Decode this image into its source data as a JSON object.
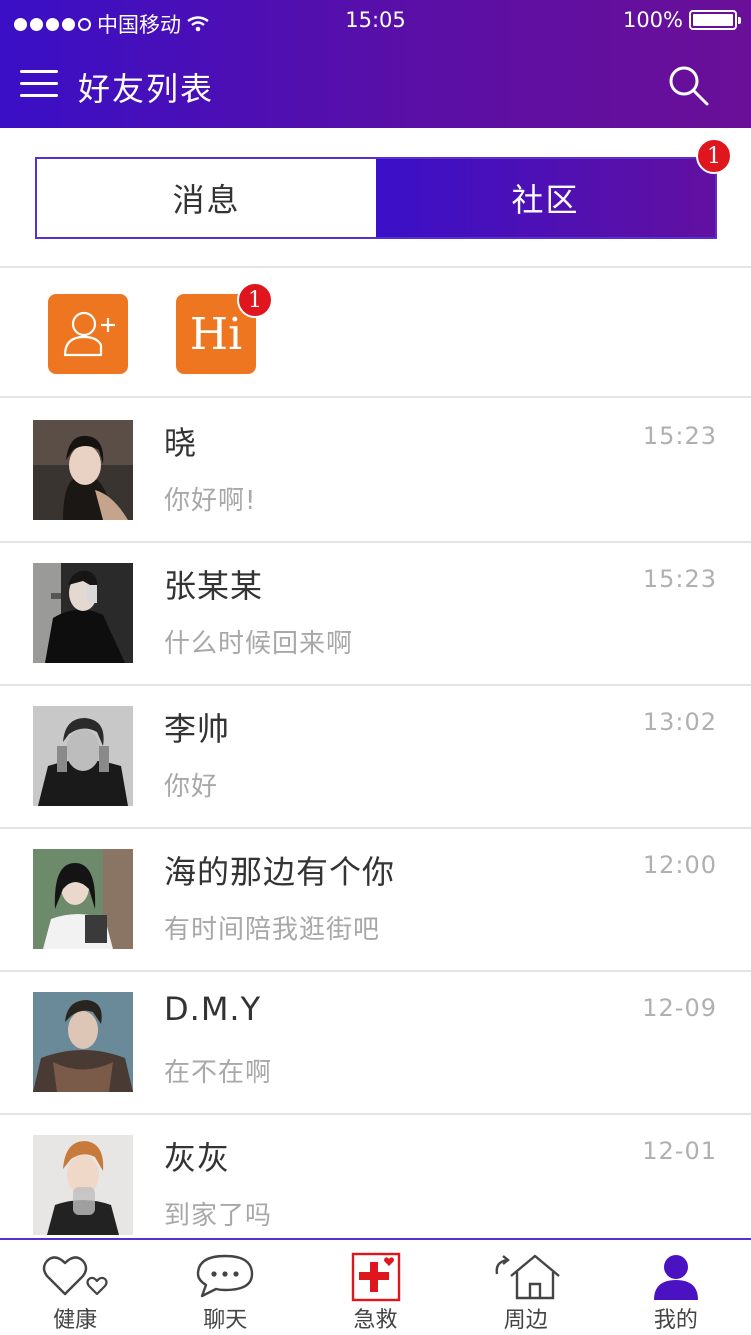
{
  "status_bar": {
    "carrier": "中国移动",
    "time": "15:05",
    "battery": "100%"
  },
  "nav": {
    "title": "好友列表"
  },
  "tabs": {
    "messages": "消息",
    "community": "社区",
    "community_badge": "1"
  },
  "quick_actions": {
    "hi_label": "Hi",
    "hi_badge": "1"
  },
  "chats": [
    {
      "name": "晓",
      "preview": "你好啊!",
      "time": "15:23"
    },
    {
      "name": "张某某",
      "preview": "什么时候回来啊",
      "time": "15:23"
    },
    {
      "name": "李帅",
      "preview": "你好",
      "time": "13:02"
    },
    {
      "name": "海的那边有个你",
      "preview": "有时间陪我逛街吧",
      "time": "12:00"
    },
    {
      "name": "D.M.Y",
      "preview": "在不在啊",
      "time": "12-09"
    },
    {
      "name": "灰灰",
      "preview": "到家了吗",
      "time": "12-01"
    }
  ],
  "tabbar": [
    {
      "label": "健康",
      "icon": "heart-icon"
    },
    {
      "label": "聊天",
      "icon": "chat-bubble-icon"
    },
    {
      "label": "急救",
      "icon": "first-aid-icon"
    },
    {
      "label": "周边",
      "icon": "home-icon"
    },
    {
      "label": "我的",
      "icon": "user-icon"
    }
  ],
  "colors": {
    "accent": "#4a12c0",
    "badge": "#e0161e",
    "orange": "#ef7620",
    "first_aid": "#e0161e"
  }
}
